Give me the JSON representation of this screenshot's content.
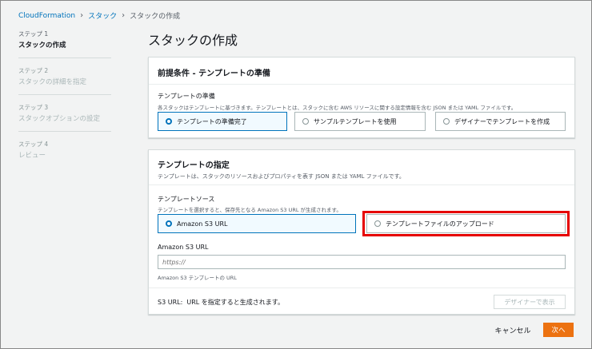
{
  "breadcrumb": {
    "items": [
      "CloudFormation",
      "スタック",
      "スタックの作成"
    ]
  },
  "steps": [
    {
      "num": "ステップ 1",
      "name": "スタックの作成"
    },
    {
      "num": "ステップ 2",
      "name": "スタックの詳細を指定"
    },
    {
      "num": "ステップ 3",
      "name": "スタックオプションの設定"
    },
    {
      "num": "ステップ 4",
      "name": "レビュー"
    }
  ],
  "page_title": "スタックの作成",
  "prereq": {
    "title": "前提条件 - テンプレートの準備",
    "field_label": "テンプレートの準備",
    "field_desc": "各スタックはテンプレートに基づきます。テンプレートとは、スタックに含む AWS リソースに関する設定情報を含む JSON または YAML ファイルです。",
    "options": [
      "テンプレートの準備完了",
      "サンプルテンプレートを使用",
      "デザイナーでテンプレートを作成"
    ],
    "selected_index": 0
  },
  "template": {
    "title": "テンプレートの指定",
    "desc": "テンプレートは、スタックのリソースおよびプロパティを表す JSON または YAML ファイルです。",
    "source_label": "テンプレートソース",
    "source_desc": "テンプレートを選択すると、保存先となる Amazon S3 URL が生成されます。",
    "options": [
      "Amazon S3 URL",
      "テンプレートファイルのアップロード"
    ],
    "selected_index": 0,
    "url_label": "Amazon S3 URL",
    "url_placeholder": "https://",
    "url_hint": "Amazon S3 テンプレートの URL",
    "footer_text": "S3 URL:  URL を指定すると生成されます。",
    "designer_button": "デザイナーで表示"
  },
  "actions": {
    "cancel": "キャンセル",
    "next": "次へ"
  },
  "colors": {
    "link": "#0073bb",
    "primary": "#ec7211",
    "highlight": "#e60000"
  }
}
